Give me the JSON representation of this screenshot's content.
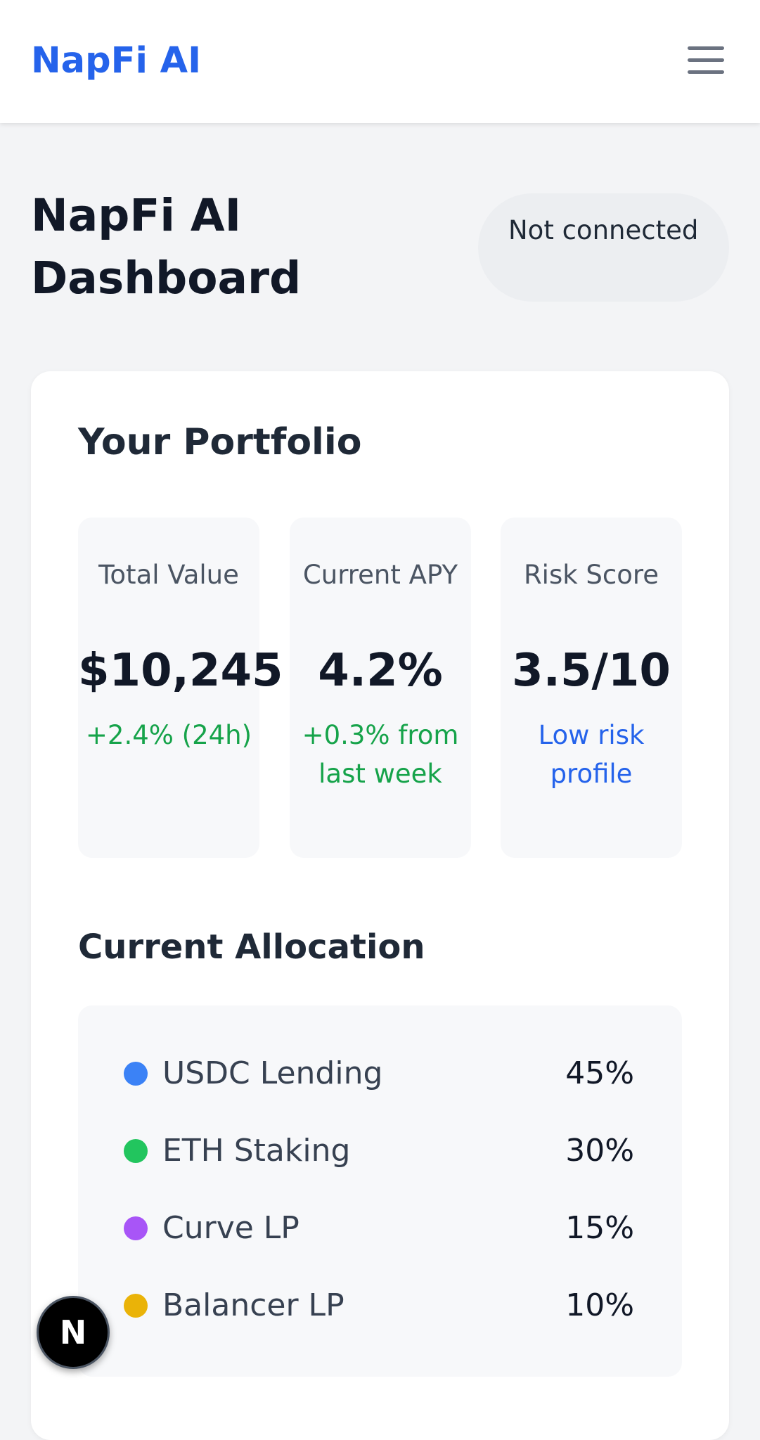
{
  "navbar": {
    "brand": "NapFi AI",
    "menu_icon": "hamburger-menu-icon"
  },
  "header": {
    "title": "NapFi AI Dashboard",
    "connection_status": "Not connected"
  },
  "portfolio": {
    "title": "Your Portfolio",
    "stats": [
      {
        "label": "Total Value",
        "value": "$10,245",
        "sub": "+2.4% (24h)",
        "sub_color": "#16a34a"
      },
      {
        "label": "Current APY",
        "value": "4.2%",
        "sub": "+0.3% from last week",
        "sub_color": "#16a34a"
      },
      {
        "label": "Risk Score",
        "value": "3.5/10",
        "sub": "Low risk profile",
        "sub_color": "#2563eb"
      }
    ]
  },
  "allocation": {
    "title": "Current Allocation",
    "items": [
      {
        "name": "USDC Lending",
        "percent": "45%",
        "color": "#3b82f6"
      },
      {
        "name": "ETH Staking",
        "percent": "30%",
        "color": "#22c55e"
      },
      {
        "name": "Curve LP",
        "percent": "15%",
        "color": "#a855f7"
      },
      {
        "name": "Balancer LP",
        "percent": "10%",
        "color": "#eab308"
      }
    ]
  },
  "dev_badge": {
    "letter": "N",
    "icon": "nextjs-logo-icon"
  },
  "colors": {
    "brand": "#2563eb",
    "positive": "#16a34a",
    "info": "#2563eb"
  }
}
